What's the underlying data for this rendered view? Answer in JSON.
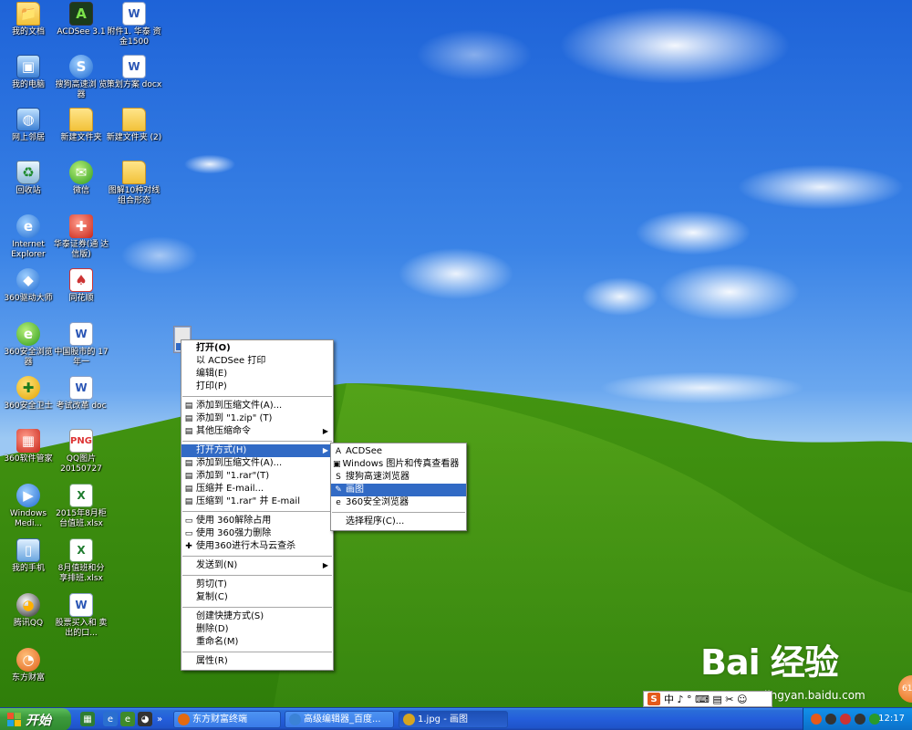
{
  "desktop": {
    "icons": [
      {
        "label": "我的文档",
        "glyph": "📁",
        "kind": "folder"
      },
      {
        "label": "ACDSee 3.1",
        "glyph": "A",
        "kind": "dark"
      },
      {
        "label": "附件1. 华泰 资金1500",
        "glyph": "W",
        "kind": "word"
      },
      {
        "label": "我的电脑",
        "glyph": "▣",
        "kind": "comp"
      },
      {
        "label": "搜狗高速浏 览器",
        "glyph": "S",
        "kind": "blue"
      },
      {
        "label": "策划方案 docx",
        "glyph": "W",
        "kind": "word"
      },
      {
        "label": "网上邻居",
        "glyph": "◍",
        "kind": "comp"
      },
      {
        "label": "新建文件夹",
        "glyph": "",
        "kind": "folder"
      },
      {
        "label": "新建文件夹 (2)",
        "glyph": "",
        "kind": "folder"
      },
      {
        "label": "回收站",
        "glyph": "♻",
        "kind": "bin"
      },
      {
        "label": "微信",
        "glyph": "✉",
        "kind": "green"
      },
      {
        "label": "图解10种对线 组合形态",
        "glyph": "",
        "kind": "folder"
      },
      {
        "label": "Internet Explorer",
        "glyph": "e",
        "kind": "blue"
      },
      {
        "label": "华泰证券(通 达信版)",
        "glyph": "✚",
        "kind": "red"
      },
      {
        "label": "360驱动大师",
        "glyph": "◆",
        "kind": "blue"
      },
      {
        "label": "同花顺",
        "glyph": "♠",
        "kind": "cards"
      },
      {
        "label": "360安全浏览 器",
        "glyph": "e",
        "kind": "green"
      },
      {
        "label": "中国股市的 17年一",
        "glyph": "W",
        "kind": "word"
      },
      {
        "label": "360安全卫士",
        "glyph": "✚",
        "kind": "yellowg"
      },
      {
        "label": "考试改革 doc",
        "glyph": "W",
        "kind": "word"
      },
      {
        "label": "360软件管家",
        "glyph": "▦",
        "kind": "red"
      },
      {
        "label": "QQ图片 20150727",
        "glyph": "PNG",
        "kind": "img"
      },
      {
        "label": "Windows Medi...",
        "glyph": "▶",
        "kind": "blue"
      },
      {
        "label": "2015年8月柜 台值班.xlsx",
        "glyph": "X",
        "kind": "excel"
      },
      {
        "label": "我的手机",
        "glyph": "▯",
        "kind": "phone"
      },
      {
        "label": "8月值班和分 享排班.xlsx",
        "glyph": "X",
        "kind": "excel"
      },
      {
        "label": "腾讯QQ",
        "glyph": "◕",
        "kind": "qq"
      },
      {
        "label": "股票买入和 卖出的口...",
        "glyph": "W",
        "kind": "word"
      },
      {
        "label": "东方财富",
        "glyph": "◔",
        "kind": "orange"
      }
    ]
  },
  "context_menu": {
    "items": [
      {
        "label": "打开(O)",
        "bold": true
      },
      {
        "label": "以 ACDSee 打印"
      },
      {
        "label": "编辑(E)"
      },
      {
        "label": "打印(P)"
      },
      {
        "sep": true
      },
      {
        "label": "添加到压缩文件(A)...",
        "icon": "▤"
      },
      {
        "label": "添加到 \"1.zip\" (T)",
        "icon": "▤"
      },
      {
        "label": "其他压缩命令",
        "icon": "▤",
        "submenu": true
      },
      {
        "sep": true
      },
      {
        "label": "打开方式(H)",
        "submenu": true,
        "highlight": true
      },
      {
        "label": "添加到压缩文件(A)...",
        "icon": "▤"
      },
      {
        "label": "添加到 \"1.rar\"(T)",
        "icon": "▤"
      },
      {
        "label": "压缩并 E-mail...",
        "icon": "▤"
      },
      {
        "label": "压缩到 \"1.rar\" 并 E-mail",
        "icon": "▤"
      },
      {
        "sep": true
      },
      {
        "label": "使用 360解除占用",
        "icon": "▭"
      },
      {
        "label": "使用 360强力删除",
        "icon": "▭"
      },
      {
        "label": "使用360进行木马云查杀",
        "icon": "✚"
      },
      {
        "sep": true
      },
      {
        "label": "发送到(N)",
        "submenu": true
      },
      {
        "sep": true
      },
      {
        "label": "剪切(T)"
      },
      {
        "label": "复制(C)"
      },
      {
        "sep": true
      },
      {
        "label": "创建快捷方式(S)"
      },
      {
        "label": "删除(D)"
      },
      {
        "label": "重命名(M)"
      },
      {
        "sep": true
      },
      {
        "label": "属性(R)"
      }
    ]
  },
  "open_with_menu": {
    "items": [
      {
        "label": "ACDSee",
        "icon": "A"
      },
      {
        "label": "Windows 图片和传真查看器",
        "icon": "▣"
      },
      {
        "label": "搜狗高速浏览器",
        "icon": "S"
      },
      {
        "label": "画图",
        "icon": "✎",
        "highlight": true
      },
      {
        "label": "360安全浏览器",
        "icon": "e"
      },
      {
        "sep": true
      },
      {
        "label": "选择程序(C)..."
      }
    ]
  },
  "taskbar": {
    "start_label": "开始",
    "quick_launch_more": "»",
    "tasks": [
      {
        "label": "东方财富终端",
        "color": "#e36a10"
      },
      {
        "label": "高级编辑器_百度...",
        "color": "#3b82d6"
      },
      {
        "label": "1.jpg - 画图",
        "color": "#d6a520",
        "active": true
      }
    ],
    "clock": "12:17"
  },
  "ime": {
    "logo": "S",
    "text": "中 ♪ ° ⌨ ▤ ✂ ☺"
  },
  "watermark": {
    "text": "Bai 经验",
    "url": "jingyan.baidu.com"
  },
  "badge": "61"
}
